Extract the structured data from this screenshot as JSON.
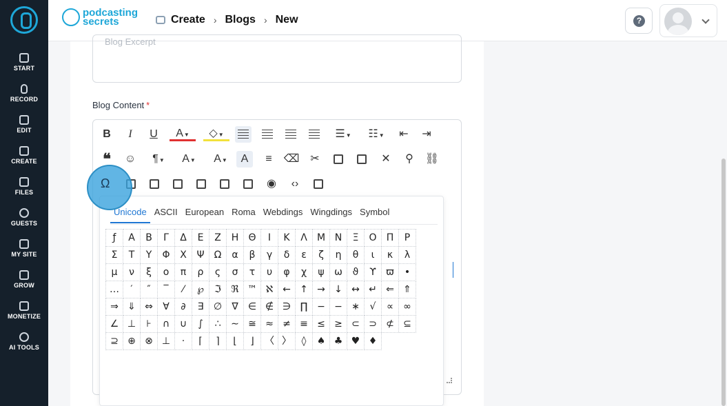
{
  "sidebar": {
    "items": [
      {
        "label": "START",
        "icon": "start-icon"
      },
      {
        "label": "RECORD",
        "icon": "mic-icon"
      },
      {
        "label": "EDIT",
        "icon": "edit-icon"
      },
      {
        "label": "CREATE",
        "icon": "create-icon"
      },
      {
        "label": "FILES",
        "icon": "files-icon"
      },
      {
        "label": "GUESTS",
        "icon": "guests-icon"
      },
      {
        "label": "MY SITE",
        "icon": "site-icon"
      },
      {
        "label": "GROW",
        "icon": "grow-icon"
      },
      {
        "label": "MONETIZE",
        "icon": "monetize-icon"
      },
      {
        "label": "AI TOOLS",
        "icon": "ai-icon"
      }
    ]
  },
  "header": {
    "brand_line1": "podcasting",
    "brand_line2": "secrets",
    "breadcrumb": [
      "Create",
      "Blogs",
      "New"
    ],
    "help": "?"
  },
  "form": {
    "excerpt_placeholder": "Blog Excerpt",
    "content_label": "Blog Content",
    "required_mark": "*"
  },
  "toolbar": {
    "row1": [
      "B",
      "I",
      "U",
      "A",
      "highlight",
      "align-left",
      "align-center",
      "align-right",
      "justify",
      "ordered-list",
      "bullet-list",
      "outdent",
      "indent"
    ],
    "omega": "Ω"
  },
  "special_chars": {
    "tabs": [
      "Unicode",
      "ASCII",
      "European",
      "Roma",
      "Webdings",
      "Wingdings",
      "Symbol"
    ],
    "active_tab": "Unicode",
    "chars": [
      "ƒ",
      "Α",
      "Β",
      "Γ",
      "Δ",
      "Ε",
      "Ζ",
      "Η",
      "Θ",
      "Ι",
      "Κ",
      "Λ",
      "Μ",
      "Ν",
      "Ξ",
      "Ο",
      "Π",
      "Ρ",
      "Σ",
      "Τ",
      "Υ",
      "Φ",
      "Χ",
      "Ψ",
      "Ω",
      "α",
      "β",
      "γ",
      "δ",
      "ε",
      "ζ",
      "η",
      "θ",
      "ι",
      "κ",
      "λ",
      "μ",
      "ν",
      "ξ",
      "ο",
      "π",
      "ρ",
      "ς",
      "σ",
      "τ",
      "υ",
      "φ",
      "χ",
      "ψ",
      "ω",
      "ϑ",
      "ϒ",
      "ϖ",
      "•",
      "…",
      "′",
      "″",
      "‾",
      "⁄",
      "℘",
      "ℑ",
      "ℜ",
      "™",
      "ℵ",
      "←",
      "↑",
      "→",
      "↓",
      "↔",
      "↵",
      "⇐",
      "⇑",
      "⇒",
      "⇓",
      "⇔",
      "∀",
      "∂",
      "∃",
      "∅",
      "∇",
      "∈",
      "∉",
      "∋",
      "∏",
      "−",
      "−",
      "∗",
      "√",
      "∝",
      "∞",
      "∠",
      "⊥",
      "⊦",
      "∩",
      "∪",
      "∫",
      "∴",
      "∼",
      "≅",
      "≈",
      "≠",
      "≡",
      "≤",
      "≥",
      "⊂",
      "⊃",
      "⊄",
      "⊆",
      "⊇",
      "⊕",
      "⊗",
      "⊥",
      "⋅",
      "⌈",
      "⌉",
      "⌊",
      "⌋",
      "〈",
      "〉",
      "◊",
      "♠",
      "♣",
      "♥",
      "♦"
    ]
  }
}
